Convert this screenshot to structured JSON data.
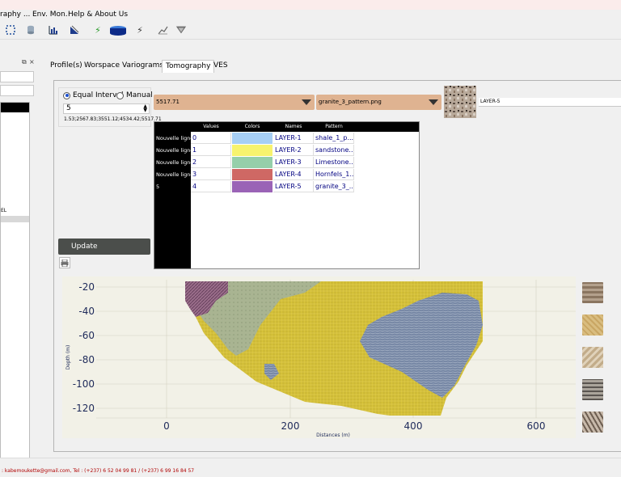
{
  "menu": [
    "raphy ...",
    "Env. Mon.",
    "Help & About Us"
  ],
  "toolbar_icons": [
    "select-icon",
    "database-icon",
    "histogram-icon",
    "profile-icon",
    "bolt-icon",
    "ves-cube-icon",
    "bolt-icon",
    "chart-icon",
    "funnel-icon"
  ],
  "left_panel": {
    "float_label": "⧉",
    "close_label": "×",
    "item_label": "EL"
  },
  "tabs": [
    "Profile(s)",
    "Worspace",
    "Variograms",
    "Tomography",
    "VES"
  ],
  "active_tab": "Tomography",
  "interval": {
    "equal_label": "Equal Interval",
    "manual_label": "Manual",
    "count": "5",
    "values_text": "1.53;2567.83;3551.12;4534.42;5517.71"
  },
  "value_combo": "5517.71",
  "pattern_combo": "granite_3_pattern.png",
  "layer_name_field": "LAYER-5",
  "table": {
    "columns": [
      "Values",
      "Colors",
      "Names",
      "Pattern"
    ],
    "rows": [
      {
        "header": "Nouvelle ligne",
        "value": "0",
        "color": "#a7cff5",
        "name": "LAYER-1",
        "pattern": "shale_1_p..."
      },
      {
        "header": "Nouvelle ligne",
        "value": "1",
        "color": "#f7f36e",
        "name": "LAYER-2",
        "pattern": "sandstone..."
      },
      {
        "header": "Nouvelle ligne",
        "value": "2",
        "color": "#95cfaa",
        "name": "LAYER-3",
        "pattern": "Limestone..."
      },
      {
        "header": "Nouvelle ligne",
        "value": "3",
        "color": "#cf6864",
        "name": "LAYER-4",
        "pattern": "Hornfels_1..."
      },
      {
        "header": "5",
        "value": "4",
        "color": "#9a63b6",
        "name": "LAYER-5",
        "pattern": "granite_3_..."
      }
    ]
  },
  "update_label": "Update",
  "plot": {
    "ylabel": "Depth (m)",
    "xlabel": "Distances (m)",
    "yticks": [
      "-20",
      "-40",
      "-60",
      "-80",
      "-100",
      "-120"
    ],
    "xticks": [
      "0",
      "200",
      "400",
      "600"
    ]
  },
  "status": {
    "contact": ": kabemoukette@gmail.com, Tel : (+237) 6 52 04 99 81 / (+237) 6 99 16 84 57"
  },
  "colors": {
    "combo_bg": "#dfb391",
    "update_bg": "#4b4e4b",
    "plot_bg": "#f2f1e7",
    "text_blue": "#000080",
    "yellow_layer": "#dcc83c",
    "blue_layer": "#7d8fae",
    "green_layer": "#a5b394",
    "purple_layer": "#9a6d8a"
  }
}
